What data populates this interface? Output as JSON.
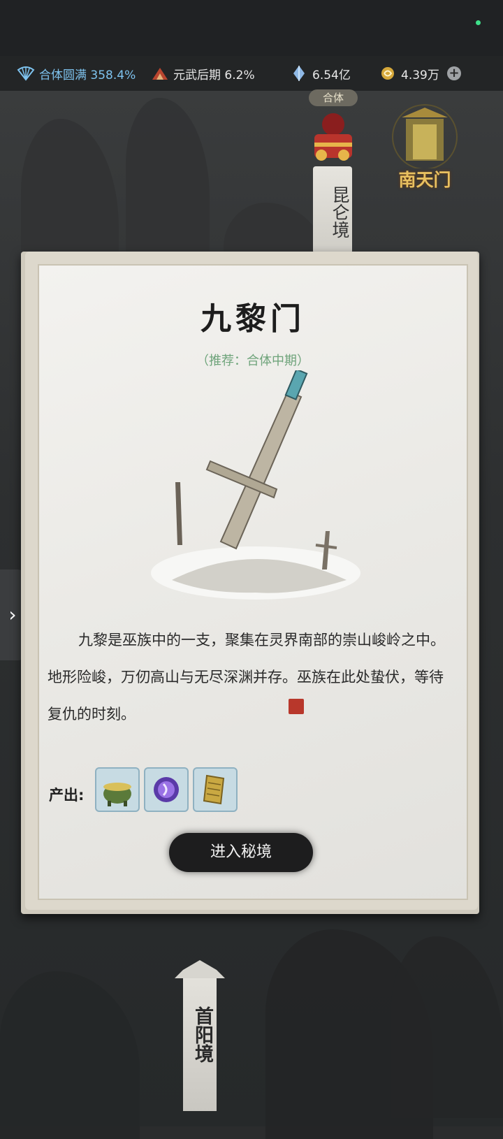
{
  "status": {
    "realm_level": "合体圆满 358.4%",
    "wu_level": "元武后期 6.2%",
    "gems": "6.54亿",
    "coins": "4.39万"
  },
  "map": {
    "current_realm_tag": "合体",
    "upper_realm_label": "昆仑境",
    "gate_label": "南天门",
    "lower_realm_label": "首阳境"
  },
  "dungeon": {
    "title": "九黎门",
    "recommend": "（推荐：合体中期）",
    "description": "九黎是巫族中的一支，聚集在灵界南部的崇山峻岭之中。地形险峻，万仞高山与无尽深渊并存。巫族在此处蛰伏，等待复仇的时刻。",
    "output_label": "产出:",
    "outputs": [
      "cauldron-icon",
      "purple-orb-icon",
      "golden-scroll-icon"
    ],
    "enter_label": "进入秘境"
  },
  "colors": {
    "level_text": "#7ec3ef",
    "recommend_text": "#6fa47b",
    "button_bg": "#1d1d1e"
  }
}
